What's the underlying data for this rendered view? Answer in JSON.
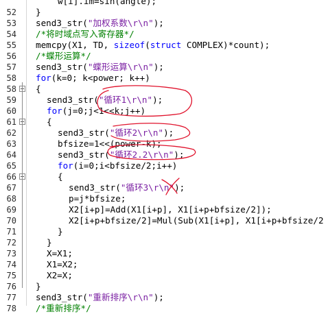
{
  "lines": [
    {
      "n": "",
      "indent": 5,
      "p": [
        [
          "t",
          "w[i].im=sin(angle);"
        ]
      ]
    },
    {
      "n": "52",
      "indent": 3,
      "p": [
        [
          "t",
          "}"
        ]
      ]
    },
    {
      "n": "53",
      "indent": 3,
      "p": [
        [
          "t",
          "send3_str("
        ],
        [
          "s",
          "\"加权系数\\r\\n\""
        ],
        [
          "t",
          ");"
        ]
      ]
    },
    {
      "n": "54",
      "indent": 3,
      "p": [
        [
          "c",
          "/*将时域点写入寄存器*/"
        ]
      ]
    },
    {
      "n": "55",
      "indent": 3,
      "p": [
        [
          "t",
          "memcpy(X1, TD, "
        ],
        [
          "k",
          "sizeof"
        ],
        [
          "t",
          "("
        ],
        [
          "k",
          "struct"
        ],
        [
          "t",
          " COMPLEX)*count);"
        ]
      ]
    },
    {
      "n": "56",
      "indent": 3,
      "p": [
        [
          "c",
          "/*蝶形运算*/"
        ]
      ]
    },
    {
      "n": "57",
      "indent": 3,
      "p": [
        [
          "t",
          "send3_str("
        ],
        [
          "s",
          "\"蝶形运算\\r\\n\""
        ],
        [
          "t",
          ");"
        ]
      ]
    },
    {
      "n": "58",
      "indent": 3,
      "p": [
        [
          "k",
          "for"
        ],
        [
          "t",
          "(k=0; k<power; k++)"
        ]
      ]
    },
    {
      "n": "58",
      "indent": 3,
      "p": [
        [
          "t",
          "{"
        ]
      ]
    },
    {
      "n": "59",
      "indent": 4,
      "p": [
        [
          "t",
          "send3_str("
        ],
        [
          "s",
          "\"循环1\\r\\n\""
        ],
        [
          "t",
          ");"
        ]
      ]
    },
    {
      "n": "60",
      "indent": 4,
      "p": [
        [
          "k",
          "for"
        ],
        [
          "t",
          "(j=0;j<1<<k;j++)"
        ]
      ]
    },
    {
      "n": "61",
      "indent": 4,
      "p": [
        [
          "t",
          "{"
        ]
      ]
    },
    {
      "n": "62",
      "indent": 5,
      "p": [
        [
          "t",
          "send3_str("
        ],
        [
          "s",
          "\"循环2\\r\\n\""
        ],
        [
          "t",
          ");"
        ]
      ]
    },
    {
      "n": "63",
      "indent": 5,
      "p": [
        [
          "t",
          "bfsize=1<<(power-k);"
        ]
      ]
    },
    {
      "n": "64",
      "indent": 5,
      "p": [
        [
          "t",
          "send3_str("
        ],
        [
          "s",
          "\"循环2.2\\r\\n\""
        ],
        [
          "t",
          ");"
        ]
      ]
    },
    {
      "n": "65",
      "indent": 5,
      "p": [
        [
          "k",
          "for"
        ],
        [
          "t",
          "(i=0;i<bfsize/2;i++)"
        ]
      ]
    },
    {
      "n": "66",
      "indent": 5,
      "p": [
        [
          "t",
          "{"
        ]
      ]
    },
    {
      "n": "67",
      "indent": 6,
      "p": [
        [
          "t",
          "send3_str("
        ],
        [
          "s",
          "\"循环3\\r\\n\""
        ],
        [
          "t",
          ");"
        ]
      ]
    },
    {
      "n": "68",
      "indent": 6,
      "p": [
        [
          "t",
          "p=j*bfsize;"
        ]
      ]
    },
    {
      "n": "69",
      "indent": 6,
      "p": [
        [
          "t",
          "X2[i+p]=Add(X1[i+p], X1[i+p+bfsize/2]);"
        ]
      ]
    },
    {
      "n": "70",
      "indent": 6,
      "p": [
        [
          "t",
          "X2[i+p+bfsize/2]=Mul(Sub(X1[i+p], X1[i+p+bfsize/2"
        ]
      ]
    },
    {
      "n": "71",
      "indent": 5,
      "p": [
        [
          "t",
          "}"
        ]
      ]
    },
    {
      "n": "72",
      "indent": 4,
      "p": [
        [
          "t",
          "}"
        ]
      ]
    },
    {
      "n": "73",
      "indent": 4,
      "p": [
        [
          "t",
          "X=X1;"
        ]
      ]
    },
    {
      "n": "74",
      "indent": 4,
      "p": [
        [
          "t",
          "X1=X2;"
        ]
      ]
    },
    {
      "n": "75",
      "indent": 4,
      "p": [
        [
          "t",
          "X2=X;"
        ]
      ]
    },
    {
      "n": "76",
      "indent": 3,
      "p": [
        [
          "t",
          "}"
        ]
      ]
    },
    {
      "n": "77",
      "indent": 3,
      "p": [
        [
          "t",
          "send3_str("
        ],
        [
          "s",
          "\"重新排序\\r\\n\""
        ],
        [
          "t",
          ");"
        ]
      ]
    },
    {
      "n": "78",
      "indent": 3,
      "p": [
        [
          "c",
          "/*重新排序*/"
        ]
      ]
    }
  ],
  "colors": {
    "keyword": "#0000ff",
    "string": "#7a1fa2",
    "comment": "#008000",
    "annotation_ink": "#e0112b"
  },
  "icons": {
    "fold_box": "collapse-box-icon"
  }
}
